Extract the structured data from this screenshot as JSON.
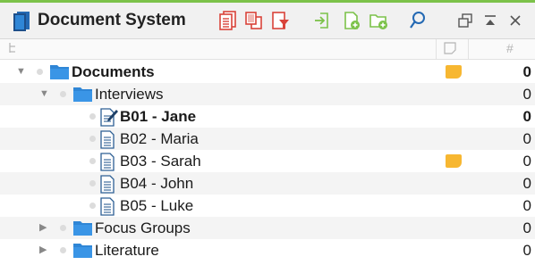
{
  "window": {
    "title": "Document System"
  },
  "toolbar": {
    "buttons": [
      "new-document-icon",
      "duplicate-document-icon",
      "filter-document-icon",
      "import-icon",
      "new-document-group-icon",
      "new-folder-icon",
      "search-icon"
    ],
    "window_buttons": [
      "undock-icon",
      "maximize-icon",
      "close-icon"
    ],
    "accent": "#d9433a"
  },
  "columns": {
    "tree_icon": "tree-icon",
    "memo_icon": "memo-column-icon",
    "count": "#"
  },
  "tree": [
    {
      "label": "Documents",
      "count": "0",
      "bold": true,
      "memo": true,
      "type": "folder",
      "expander": "▼"
    },
    {
      "label": "Interviews",
      "count": "0",
      "bold": false,
      "memo": false,
      "type": "folder",
      "expander": "▼"
    },
    {
      "label": "B01 - Jane",
      "count": "0",
      "bold": true,
      "memo": false,
      "type": "doc-edit"
    },
    {
      "label": "B02 - Maria",
      "count": "0",
      "bold": false,
      "memo": false,
      "type": "doc"
    },
    {
      "label": "B03 - Sarah",
      "count": "0",
      "bold": false,
      "memo": true,
      "type": "doc"
    },
    {
      "label": "B04 - John",
      "count": "0",
      "bold": false,
      "memo": false,
      "type": "doc"
    },
    {
      "label": "B05 - Luke",
      "count": "0",
      "bold": false,
      "memo": false,
      "type": "doc"
    },
    {
      "label": "Focus Groups",
      "count": "0",
      "bold": false,
      "memo": false,
      "type": "folder",
      "expander": "▶"
    },
    {
      "label": "Literature",
      "count": "0",
      "bold": false,
      "memo": false,
      "type": "folder",
      "expander": "▶"
    }
  ],
  "colors": {
    "folder": "#2f86d6",
    "memo": "#f7b731",
    "accent_bar": "#7cc24a",
    "title_icon": "#2469b3"
  }
}
